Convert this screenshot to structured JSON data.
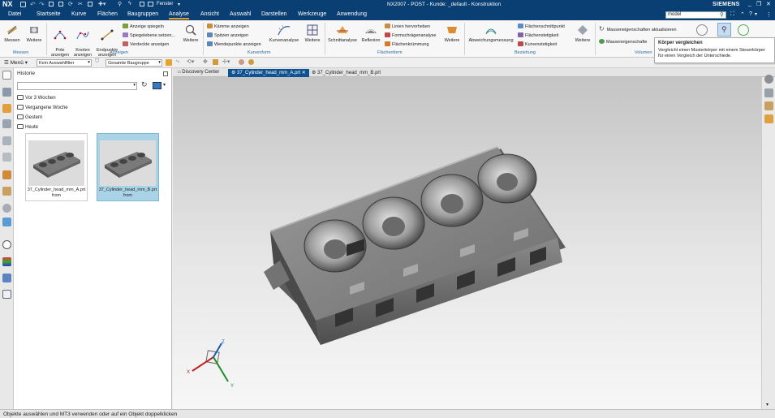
{
  "titlebar": {
    "app_logo": "NX",
    "window_menu": "Fenster",
    "title": "NX2007 - POST - Kunde: _default - Konstruktion",
    "brand": "SIEMENS",
    "search_value": "model"
  },
  "menu": {
    "items": [
      "Datei",
      "Startseite",
      "Kurve",
      "Flächen",
      "Baugruppen",
      "Analyse",
      "Ansicht",
      "Auswahl",
      "Darstellen",
      "Werkzeuge",
      "Anwendung"
    ],
    "active": "Analyse"
  },
  "ribbon": {
    "groups": {
      "messen": "Messen",
      "anzeigen": "Anzeigen",
      "kurvenform": "Kurvenform",
      "flaechenform": "Flächenform",
      "beziehung": "Beziehung",
      "volumen": "Volumen"
    },
    "buttons": {
      "messen": "Messen",
      "weitere1": "Weitere",
      "pole": "Pole\nanzeigen",
      "knoten": "Knoten\nanzeigen",
      "endpunkte": "Endpunkte\nanzeigen",
      "anzeige_spiegeln": "Anzeige spiegeln",
      "spiegelebene": "Spiegelebene setzen...",
      "verdeckte": "Verdeckte anzeigen",
      "weitere2": "Weitere",
      "kaemme": "Kämme anzeigen",
      "spitzen": "Spitzen anzeigen",
      "wendepunkte": "Wendepunkte anzeigen",
      "kurvenanalyse": "Kurvenanalyse",
      "weitere3": "Weitere",
      "schnittanalyse": "Schnittanalyse",
      "reflexion": "Reflexion",
      "linien_hervorheben": "Linien hervorheben",
      "formschraege": "Formschrägenanalyse",
      "flaechenkruemmung": "Flächenkrümmung",
      "weitere4": "Weitere",
      "abweichungsmessung": "Abweichungsmessung",
      "flaechenschnittpunkt": "Flächenschnittpunkt",
      "flaechenstetigkeit": "Flächenstetigkeit",
      "kurvenstetigkeit": "Kurvenstetigkeit",
      "weitere5": "Weitere",
      "masse_aktualisieren": "Masseneigenschaften aktualisieren",
      "masse": "Masseneigenschafte"
    }
  },
  "toolbar2": {
    "menu": "Menü",
    "filter": "Kein Auswahlfilter",
    "scope": "Gesamte Baugruppe"
  },
  "tabs": [
    {
      "label": "Discovery Center"
    },
    {
      "label": "37_Cylinder_head_mm_A.prt"
    },
    {
      "label": "37_Cylinder_head_mm_B.prt"
    }
  ],
  "navpanel": {
    "title": "Historie",
    "folders": [
      "Vor 3 Wochen",
      "Vergangene Woche",
      "Gestern",
      "Heute"
    ],
    "thumbs": [
      {
        "caption": "37_Cylinder_head_mm_A.prt\nfrom"
      },
      {
        "caption": "37_Cylinder_head_mm_B.prt\nfrom"
      }
    ]
  },
  "tooltip": {
    "title": "Körper vergleichen",
    "desc": "Vergleicht einen Musterkörper mit einem Steuerkörper für einen Vergleich der Unterschiede."
  },
  "triad": {
    "x": "X",
    "y": "Y",
    "z": "Z"
  },
  "statusbar": {
    "text": "Objekte auswählen und MT3 verwenden oder auf ein Objekt doppelklicken"
  },
  "colors": {
    "titlebar": "#0a3f73",
    "active_tab": "#0e5291",
    "accent": "#e39b2d"
  }
}
